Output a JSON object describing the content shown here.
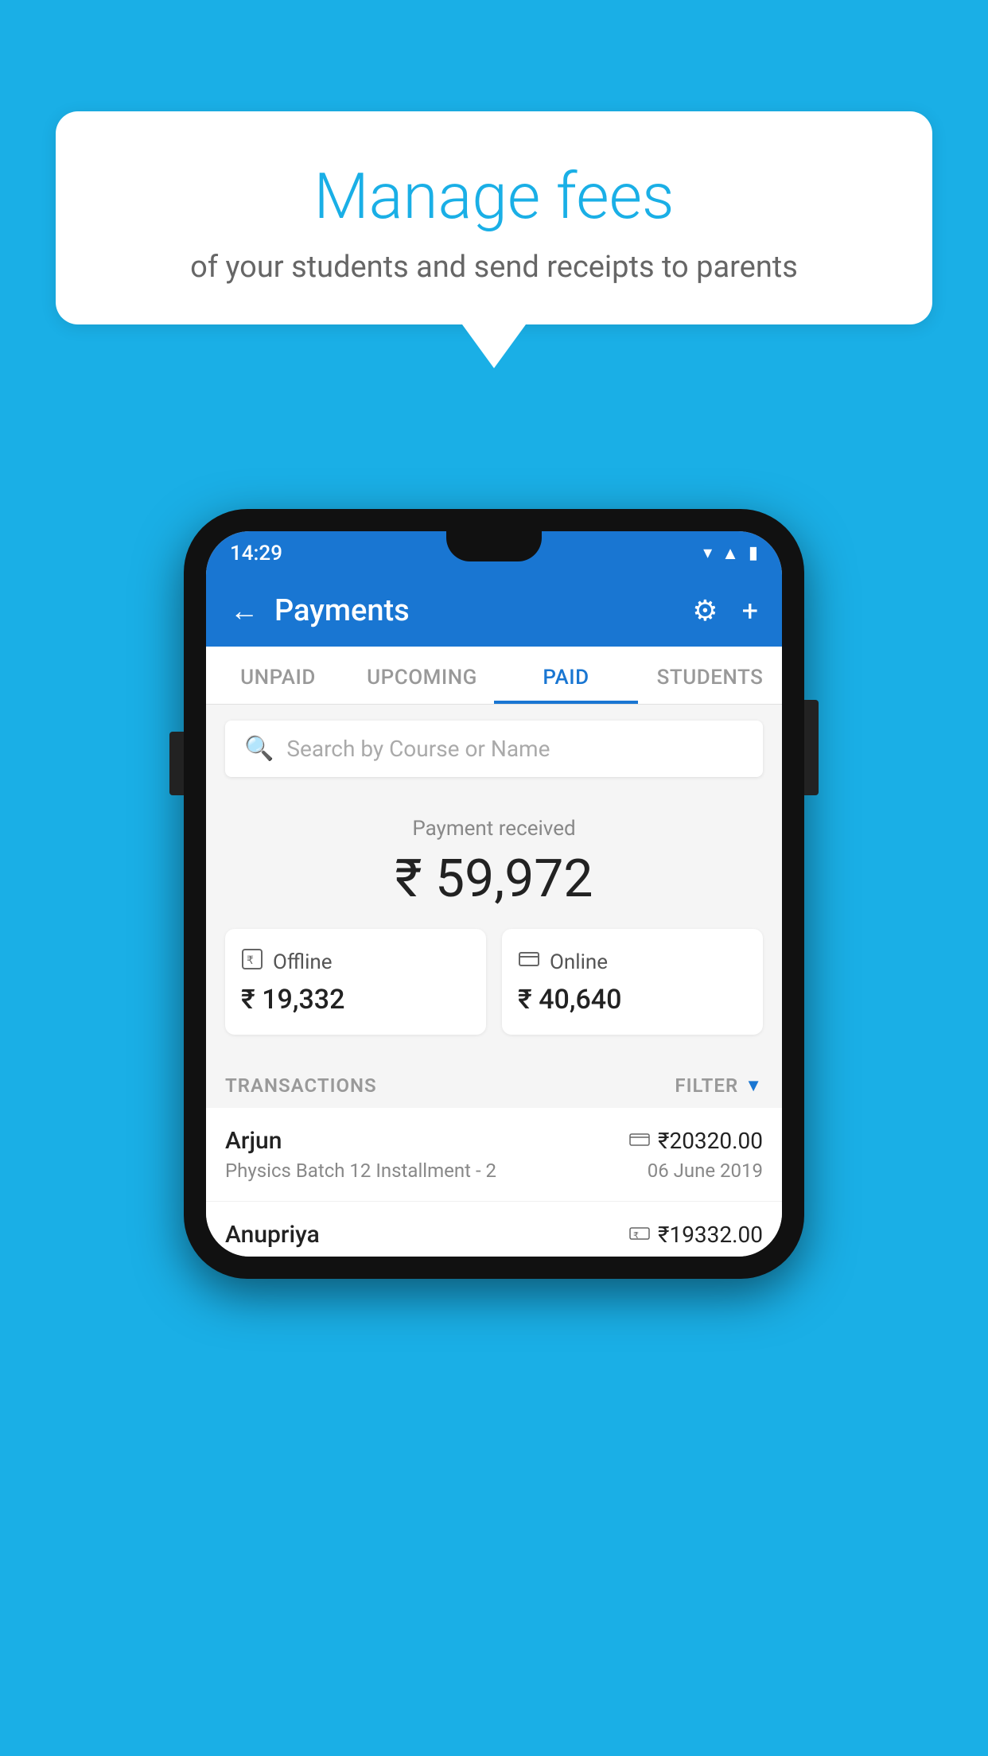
{
  "page": {
    "background_color": "#1AAFE6"
  },
  "speech_bubble": {
    "title": "Manage fees",
    "subtitle": "of your students and send receipts to parents"
  },
  "status_bar": {
    "time": "14:29",
    "wifi_icon": "▲",
    "signal_icon": "▲",
    "battery_icon": "▮"
  },
  "header": {
    "back_label": "←",
    "title": "Payments",
    "settings_icon": "⚙",
    "add_icon": "+"
  },
  "tabs": [
    {
      "label": "UNPAID",
      "active": false
    },
    {
      "label": "UPCOMING",
      "active": false
    },
    {
      "label": "PAID",
      "active": true
    },
    {
      "label": "STUDENTS",
      "active": false
    }
  ],
  "search": {
    "placeholder": "Search by Course or Name",
    "icon": "🔍"
  },
  "payment_summary": {
    "label": "Payment received",
    "total": "₹ 59,972",
    "offline": {
      "icon": "💳",
      "label": "Offline",
      "amount": "₹ 19,332"
    },
    "online": {
      "icon": "💳",
      "label": "Online",
      "amount": "₹ 40,640"
    }
  },
  "transactions": {
    "label": "TRANSACTIONS",
    "filter_label": "FILTER",
    "rows": [
      {
        "name": "Arjun",
        "amount": "₹20320.00",
        "course": "Physics Batch 12 Installment - 2",
        "date": "06 June 2019",
        "payment_type": "online"
      },
      {
        "name": "Anupriya",
        "amount": "₹19332.00",
        "course": "",
        "date": "",
        "payment_type": "offline"
      }
    ]
  }
}
